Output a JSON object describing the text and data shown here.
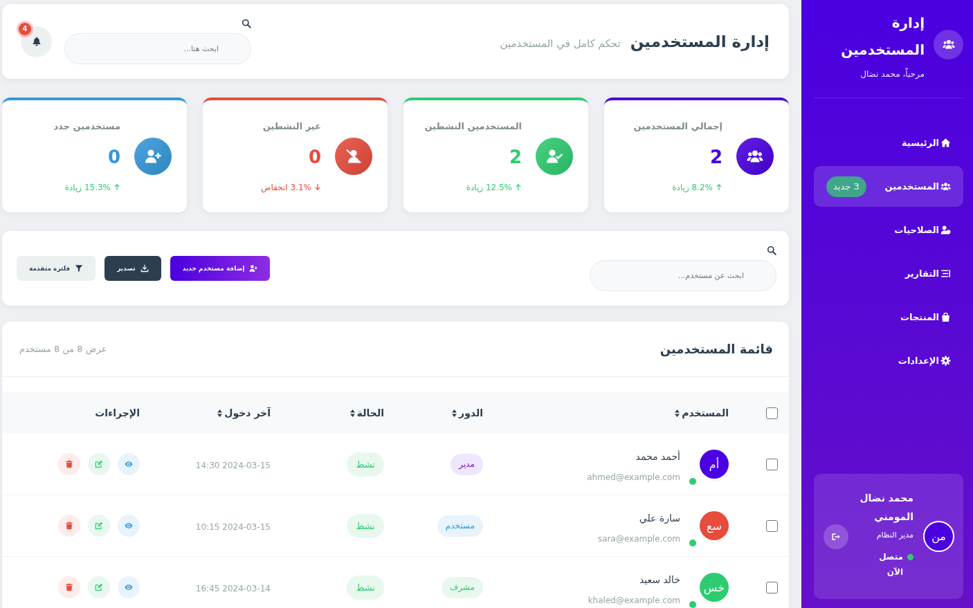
{
  "sidebar": {
    "title": "إدارة المستخدمين",
    "welcome": "مرحباً، محمد نضال",
    "items": [
      {
        "kind": "home",
        "label": "الرئيسية",
        "selected": false
      },
      {
        "kind": "users",
        "label": "المستخدمين",
        "selected": true,
        "badge": "3 جديد"
      },
      {
        "kind": "permissions",
        "label": "الصلاحيات",
        "selected": false
      },
      {
        "kind": "reports",
        "label": "التقارير",
        "selected": false
      },
      {
        "kind": "products",
        "label": "المنتجات",
        "selected": false
      },
      {
        "kind": "settings",
        "label": "الإعدادات",
        "selected": false
      }
    ],
    "user": {
      "initials": "من",
      "name": "محمد نضال المومني",
      "role": "مدير النظام",
      "online": true,
      "status": "متصل",
      "last_seen": "الآن"
    }
  },
  "header": {
    "title": "إدارة المستخدمين",
    "subtitle": "تحكم كامل في المستخدمين",
    "search": {
      "placeholder": "ابحث هنا..."
    },
    "notifications": {
      "count": "4"
    }
  },
  "stats": [
    {
      "kind": "total",
      "title": "إجمالي المستخدمين",
      "value": "2",
      "color": "#4a00e0",
      "increase": true,
      "change": "8.2% زيادة"
    },
    {
      "kind": "active",
      "title": "المستخدمين النشطين",
      "value": "2",
      "color": "#2ecc71",
      "increase": true,
      "change": "12.5% زيادة"
    },
    {
      "kind": "inactive",
      "title": "غير النشطين",
      "value": "0",
      "color": "#e74c3c",
      "increase": false,
      "change": "3.1% انخفاض"
    },
    {
      "kind": "new",
      "title": "مستخدمين جدد",
      "value": "0",
      "color": "#3498db",
      "increase": true,
      "change": "15.3% زيادة"
    }
  ],
  "toolbar": {
    "search": {
      "placeholder": "ابحث عن مستخدم..."
    },
    "buttons": [
      {
        "kind": "add",
        "label": "إضافة مستخدم جديد"
      },
      {
        "kind": "export",
        "label": "تصدير"
      },
      {
        "kind": "filter",
        "label": "فلترة متقدمة"
      }
    ]
  },
  "table": {
    "title": "قائمة المستخدمين",
    "summary": "عرض 8 من 8 مستخدم",
    "select_all": {
      "checked": false
    },
    "columns": [
      {
        "label": "المستخدم",
        "sortable": true
      },
      {
        "label": "الدور",
        "sortable": true
      },
      {
        "label": "الحالة",
        "sortable": true
      },
      {
        "label": "آخر دخول",
        "sortable": true
      },
      {
        "label": "الإجراءات",
        "sortable": false
      }
    ],
    "rows": [
      {
        "checked": false,
        "initials": "أم",
        "color": "#4a00e0",
        "online": true,
        "name": "أحمد محمد",
        "email": "ahmed@example.com",
        "role": {
          "kind": "admin",
          "label": "مدير"
        },
        "status": {
          "kind": "active",
          "label": "نشط"
        },
        "last_login": "2024-03-15 14:30"
      },
      {
        "checked": false,
        "initials": "سع",
        "color": "#e74c3c",
        "online": true,
        "name": "سارة علي",
        "email": "sara@example.com",
        "role": {
          "kind": "user",
          "label": "مستخدم"
        },
        "status": {
          "kind": "active",
          "label": "نشط"
        },
        "last_login": "2024-03-15 10:15"
      },
      {
        "checked": false,
        "initials": "خس",
        "color": "#2ecc71",
        "online": true,
        "name": "خالد سعيد",
        "email": "khaled@example.com",
        "role": {
          "kind": "supervisor",
          "label": "مشرف"
        },
        "status": {
          "kind": "active",
          "label": "نشط"
        },
        "last_login": "2024-03-14 16:45"
      }
    ]
  }
}
